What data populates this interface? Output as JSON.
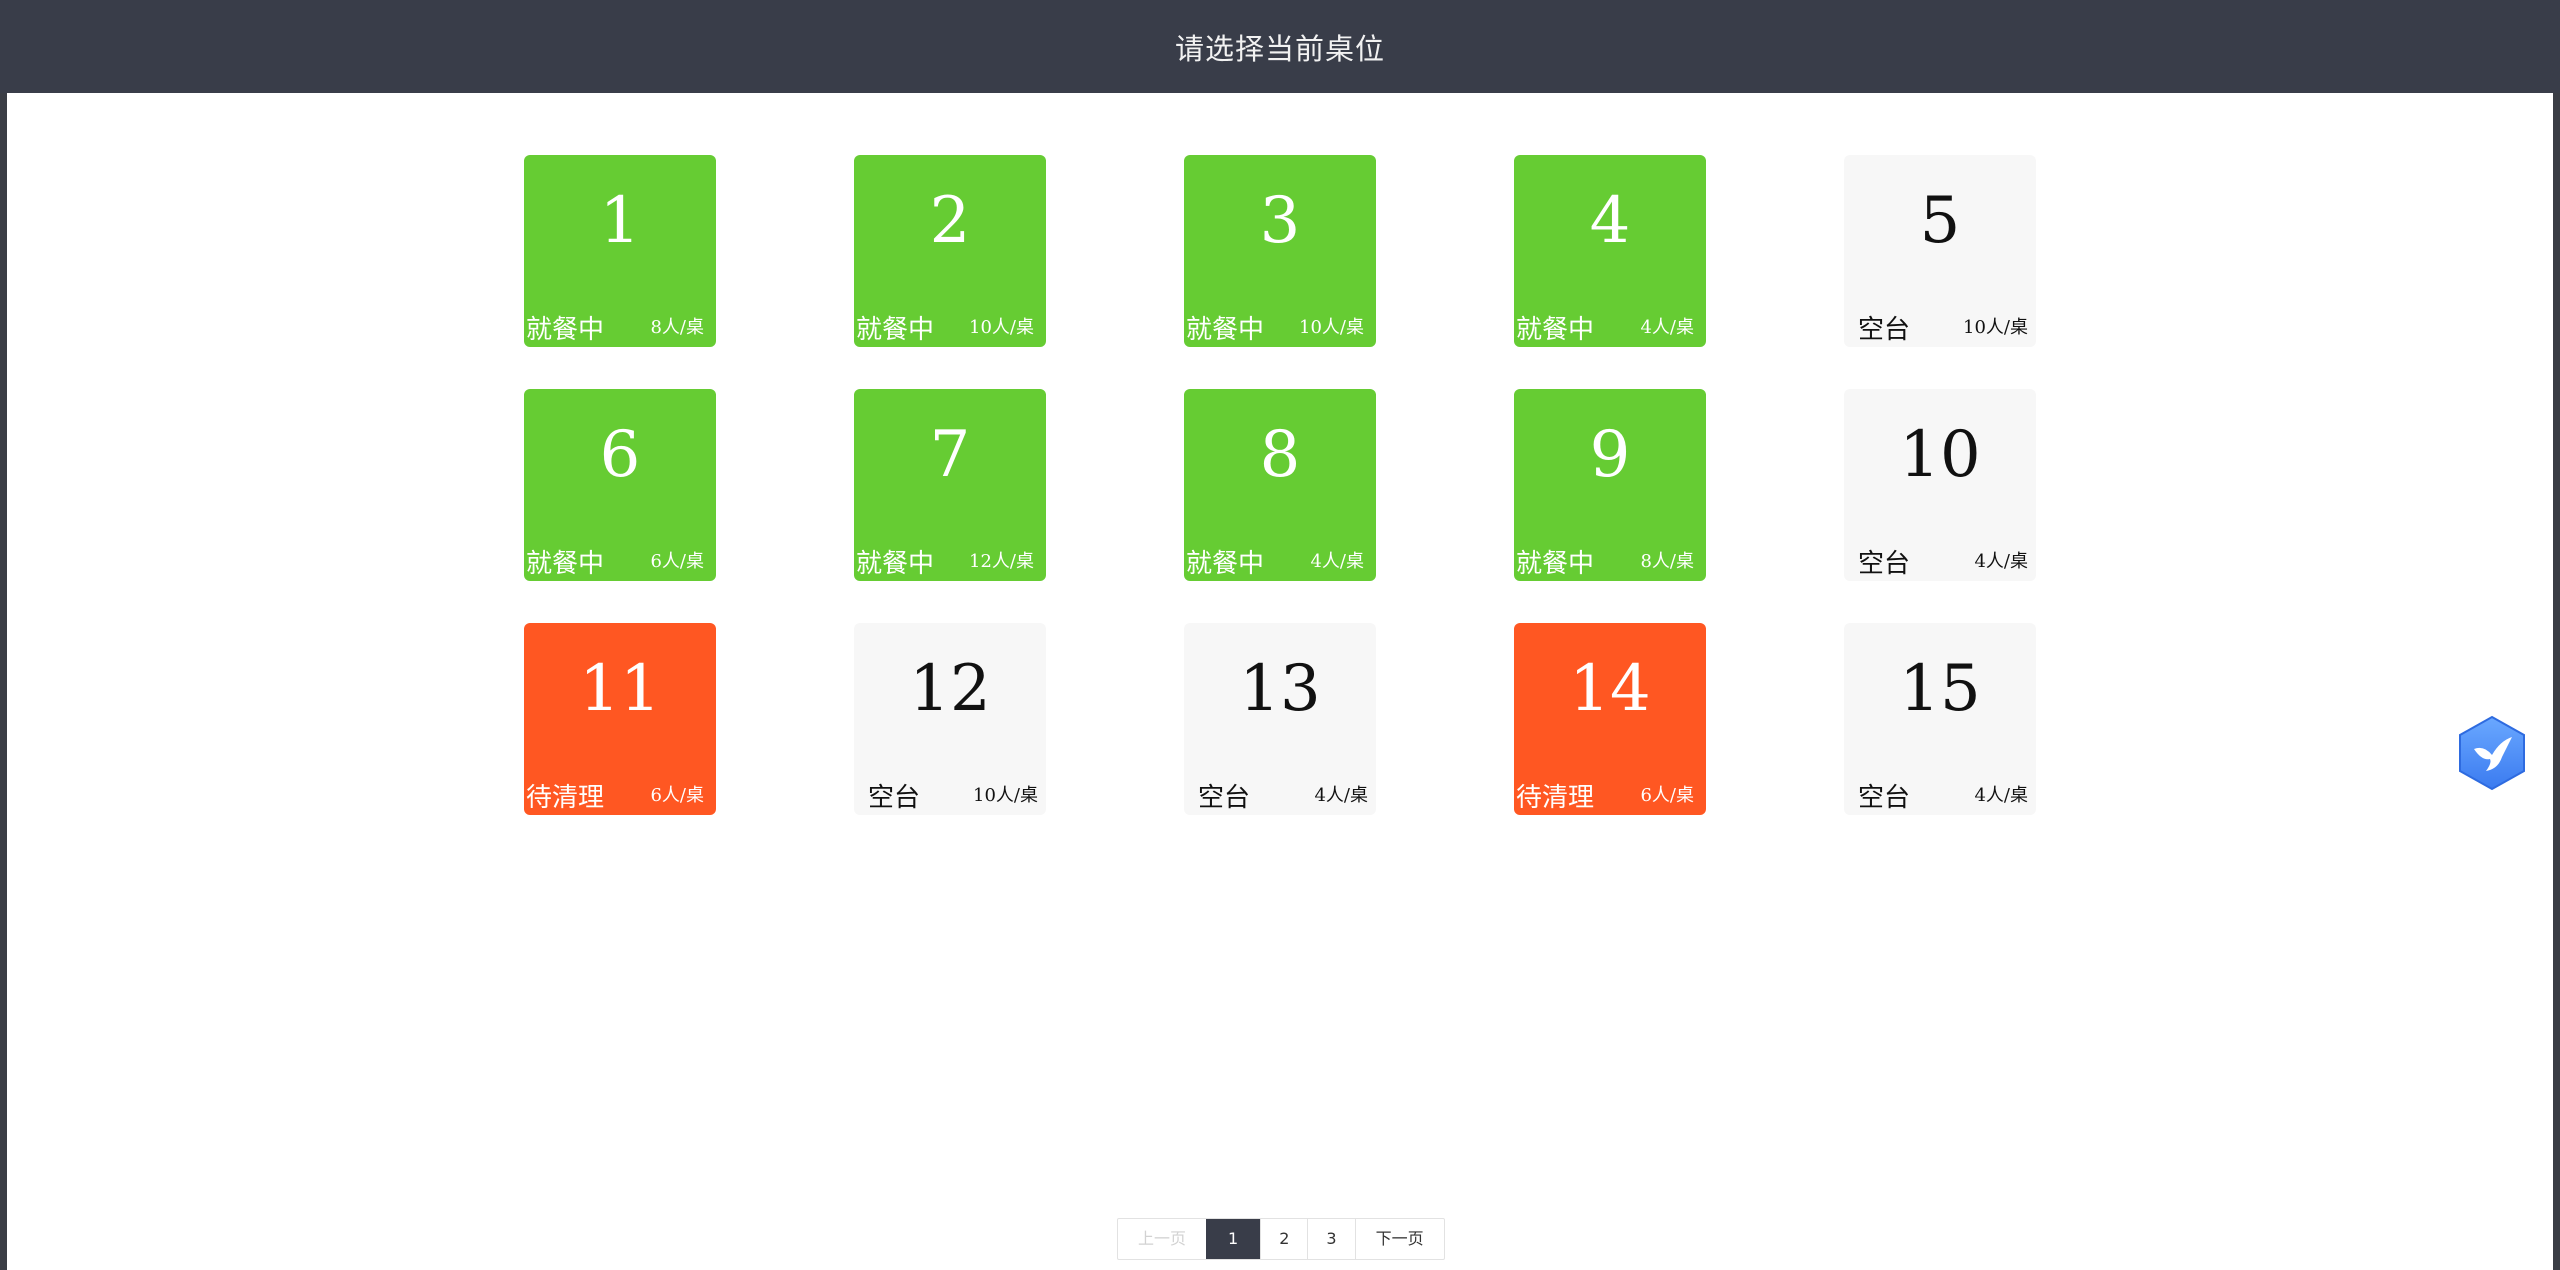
{
  "header": {
    "title": "请选择当前桌位"
  },
  "tables": [
    {
      "number": "1",
      "status": "就餐中",
      "capacity": "8人/桌",
      "state": "dining"
    },
    {
      "number": "2",
      "status": "就餐中",
      "capacity": "10人/桌",
      "state": "dining"
    },
    {
      "number": "3",
      "status": "就餐中",
      "capacity": "10人/桌",
      "state": "dining"
    },
    {
      "number": "4",
      "status": "就餐中",
      "capacity": "4人/桌",
      "state": "dining"
    },
    {
      "number": "5",
      "status": "空台",
      "capacity": "10人/桌",
      "state": "empty"
    },
    {
      "number": "6",
      "status": "就餐中",
      "capacity": "6人/桌",
      "state": "dining"
    },
    {
      "number": "7",
      "status": "就餐中",
      "capacity": "12人/桌",
      "state": "dining"
    },
    {
      "number": "8",
      "status": "就餐中",
      "capacity": "4人/桌",
      "state": "dining"
    },
    {
      "number": "9",
      "status": "就餐中",
      "capacity": "8人/桌",
      "state": "dining"
    },
    {
      "number": "10",
      "status": "空台",
      "capacity": "4人/桌",
      "state": "empty"
    },
    {
      "number": "11",
      "status": "待清理",
      "capacity": "6人/桌",
      "state": "cleaning"
    },
    {
      "number": "12",
      "status": "空台",
      "capacity": "10人/桌",
      "state": "empty"
    },
    {
      "number": "13",
      "status": "空台",
      "capacity": "4人/桌",
      "state": "empty"
    },
    {
      "number": "14",
      "status": "待清理",
      "capacity": "6人/桌",
      "state": "cleaning"
    },
    {
      "number": "15",
      "status": "空台",
      "capacity": "4人/桌",
      "state": "empty"
    }
  ],
  "colors": {
    "dining": "#66cc33",
    "cleaning": "#ff5722",
    "empty": "#f7f7f7",
    "header": "#393d49",
    "current_page": "#393d49"
  },
  "pagination": {
    "prev_label": "上一页",
    "next_label": "下一页",
    "pages": [
      "1",
      "2",
      "3"
    ],
    "current": "1"
  },
  "floating_widget": {
    "icon": "bird-hexagon-icon"
  }
}
